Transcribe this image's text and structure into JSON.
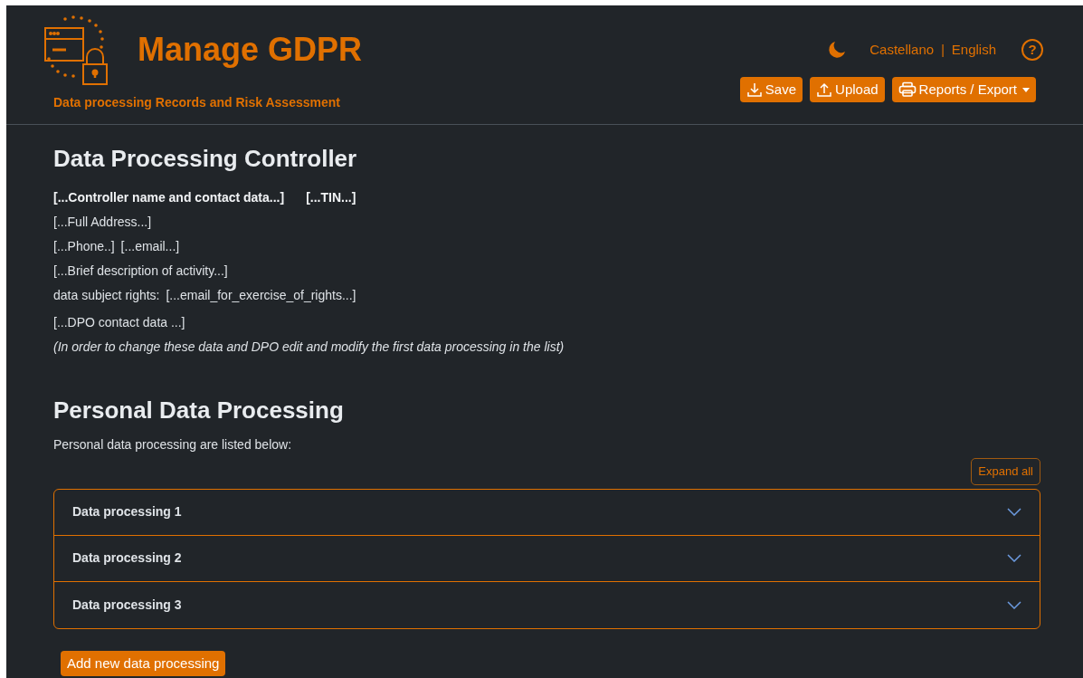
{
  "header": {
    "title": "Manage GDPR",
    "subtitle": "Data processing Records and Risk Assessment",
    "languages": [
      {
        "label": "Castellano"
      },
      {
        "label": "English"
      }
    ],
    "separator": "|",
    "help": "?",
    "buttons": [
      {
        "kind": "save",
        "label": "Save"
      },
      {
        "kind": "upload",
        "label": "Upload"
      },
      {
        "kind": "reports",
        "label": "Reports / Export",
        "dropdown": true
      }
    ]
  },
  "controller": {
    "heading": "Data Processing Controller",
    "name": "[...Controller name and contact data...]",
    "tin": "[...TIN...]",
    "address": "[...Full Address...]",
    "phone": "[...Phone..]",
    "email": "[...email...]",
    "activity": "[...Brief description of activity...]",
    "rights_label": "data subject rights:",
    "rights_email": "[...email_for_exercise_of_rights...]",
    "dpo": "[...DPO contact data ...]",
    "note": "(In order to change these data and DPO edit and modify the first data processing in the list)"
  },
  "processing": {
    "heading": "Personal Data Processing",
    "intro": "Personal data processing are listed below:",
    "expand_all": "Expand all",
    "items": [
      {
        "title": "Data processing 1",
        "expanded": false
      },
      {
        "title": "Data processing 2",
        "expanded": false
      },
      {
        "title": "Data processing 3",
        "expanded": false
      }
    ],
    "add_button": "Add new data processing"
  }
}
